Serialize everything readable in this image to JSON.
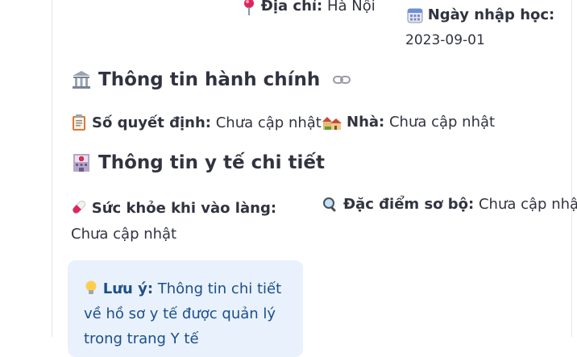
{
  "address": {
    "label": "Địa chỉ:",
    "value": "Hà Nội"
  },
  "enrollment": {
    "label": "Ngày nhập học:",
    "value": "2023-09-01"
  },
  "admin_section": {
    "title": "Thông tin hành chính",
    "decision": {
      "label": "Số quyết định:",
      "value": "Chưa cập nhật"
    },
    "house": {
      "label": "Nhà:",
      "value": "Chưa cập nhật"
    }
  },
  "medical_section": {
    "title": "Thông tin y tế chi tiết",
    "health_on_entry": {
      "label": "Sức khỏe khi vào làng:",
      "value": "Chưa cập nhật"
    },
    "preliminary": {
      "label": "Đặc điểm sơ bộ:",
      "value": "Chưa cập nhật"
    }
  },
  "note": {
    "label": "Lưu ý:",
    "text": "Thông tin chi tiết về hồ sơ y tế được quản lý trong trang Y tế"
  },
  "icons": {
    "address": "pin-icon",
    "enrollment": "calendar-icon",
    "admin": "classical-building-icon",
    "link": "link-icon",
    "decision": "clipboard-icon",
    "house": "houses-icon",
    "medical": "hospital-icon",
    "health": "pill-icon",
    "preliminary": "magnifier-icon",
    "note": "lightbulb-icon"
  },
  "colors": {
    "note_bg": "#e8f1fc",
    "note_text": "#1c4f8a",
    "text": "#31333f"
  }
}
